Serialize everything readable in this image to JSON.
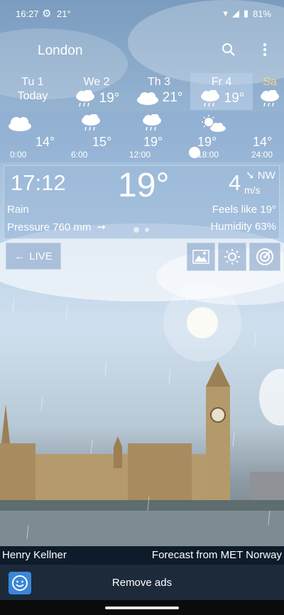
{
  "status_bar": {
    "time": "16:27",
    "temp": "21°",
    "battery": "81%"
  },
  "header": {
    "city": "London"
  },
  "days": [
    {
      "name": "Tu 1",
      "sub": "Today",
      "temp": "",
      "icon": ""
    },
    {
      "name": "We 2",
      "temp": "19°",
      "icon": "rain-cloud-icon"
    },
    {
      "name": "Th 3",
      "temp": "21°",
      "icon": "cloud-icon"
    },
    {
      "name": "Fr 4",
      "temp": "19°",
      "icon": "rain-cloud-icon",
      "selected": true
    },
    {
      "name": "Sa",
      "temp": "",
      "icon": "rain-cloud-icon"
    }
  ],
  "hours": [
    {
      "time": "0:00",
      "temp": "14°",
      "icon": "cloud-icon"
    },
    {
      "time": "6:00",
      "temp": "15°",
      "icon": "rain-cloud-icon"
    },
    {
      "time": "12:00",
      "temp": "19°",
      "icon": "rain-cloud-icon"
    },
    {
      "time": "18:00",
      "temp": "19°",
      "icon": "sun-cloud-icon"
    },
    {
      "time": "24:00",
      "temp": "14°",
      "icon": ""
    }
  ],
  "current": {
    "time": "17:12",
    "temp": "19°",
    "wind_speed": "4",
    "wind_unit": "m/s",
    "wind_dir": "NW",
    "condition": "Rain",
    "feels_like": "Feels like 19°",
    "pressure": "Pressure 760 mm",
    "humidity": "Humidity 63%"
  },
  "controls": {
    "live_label": "LIVE"
  },
  "footer": {
    "author": "Henry Kellner",
    "source": "Forecast from MET Norway",
    "ads": "Remove ads"
  }
}
